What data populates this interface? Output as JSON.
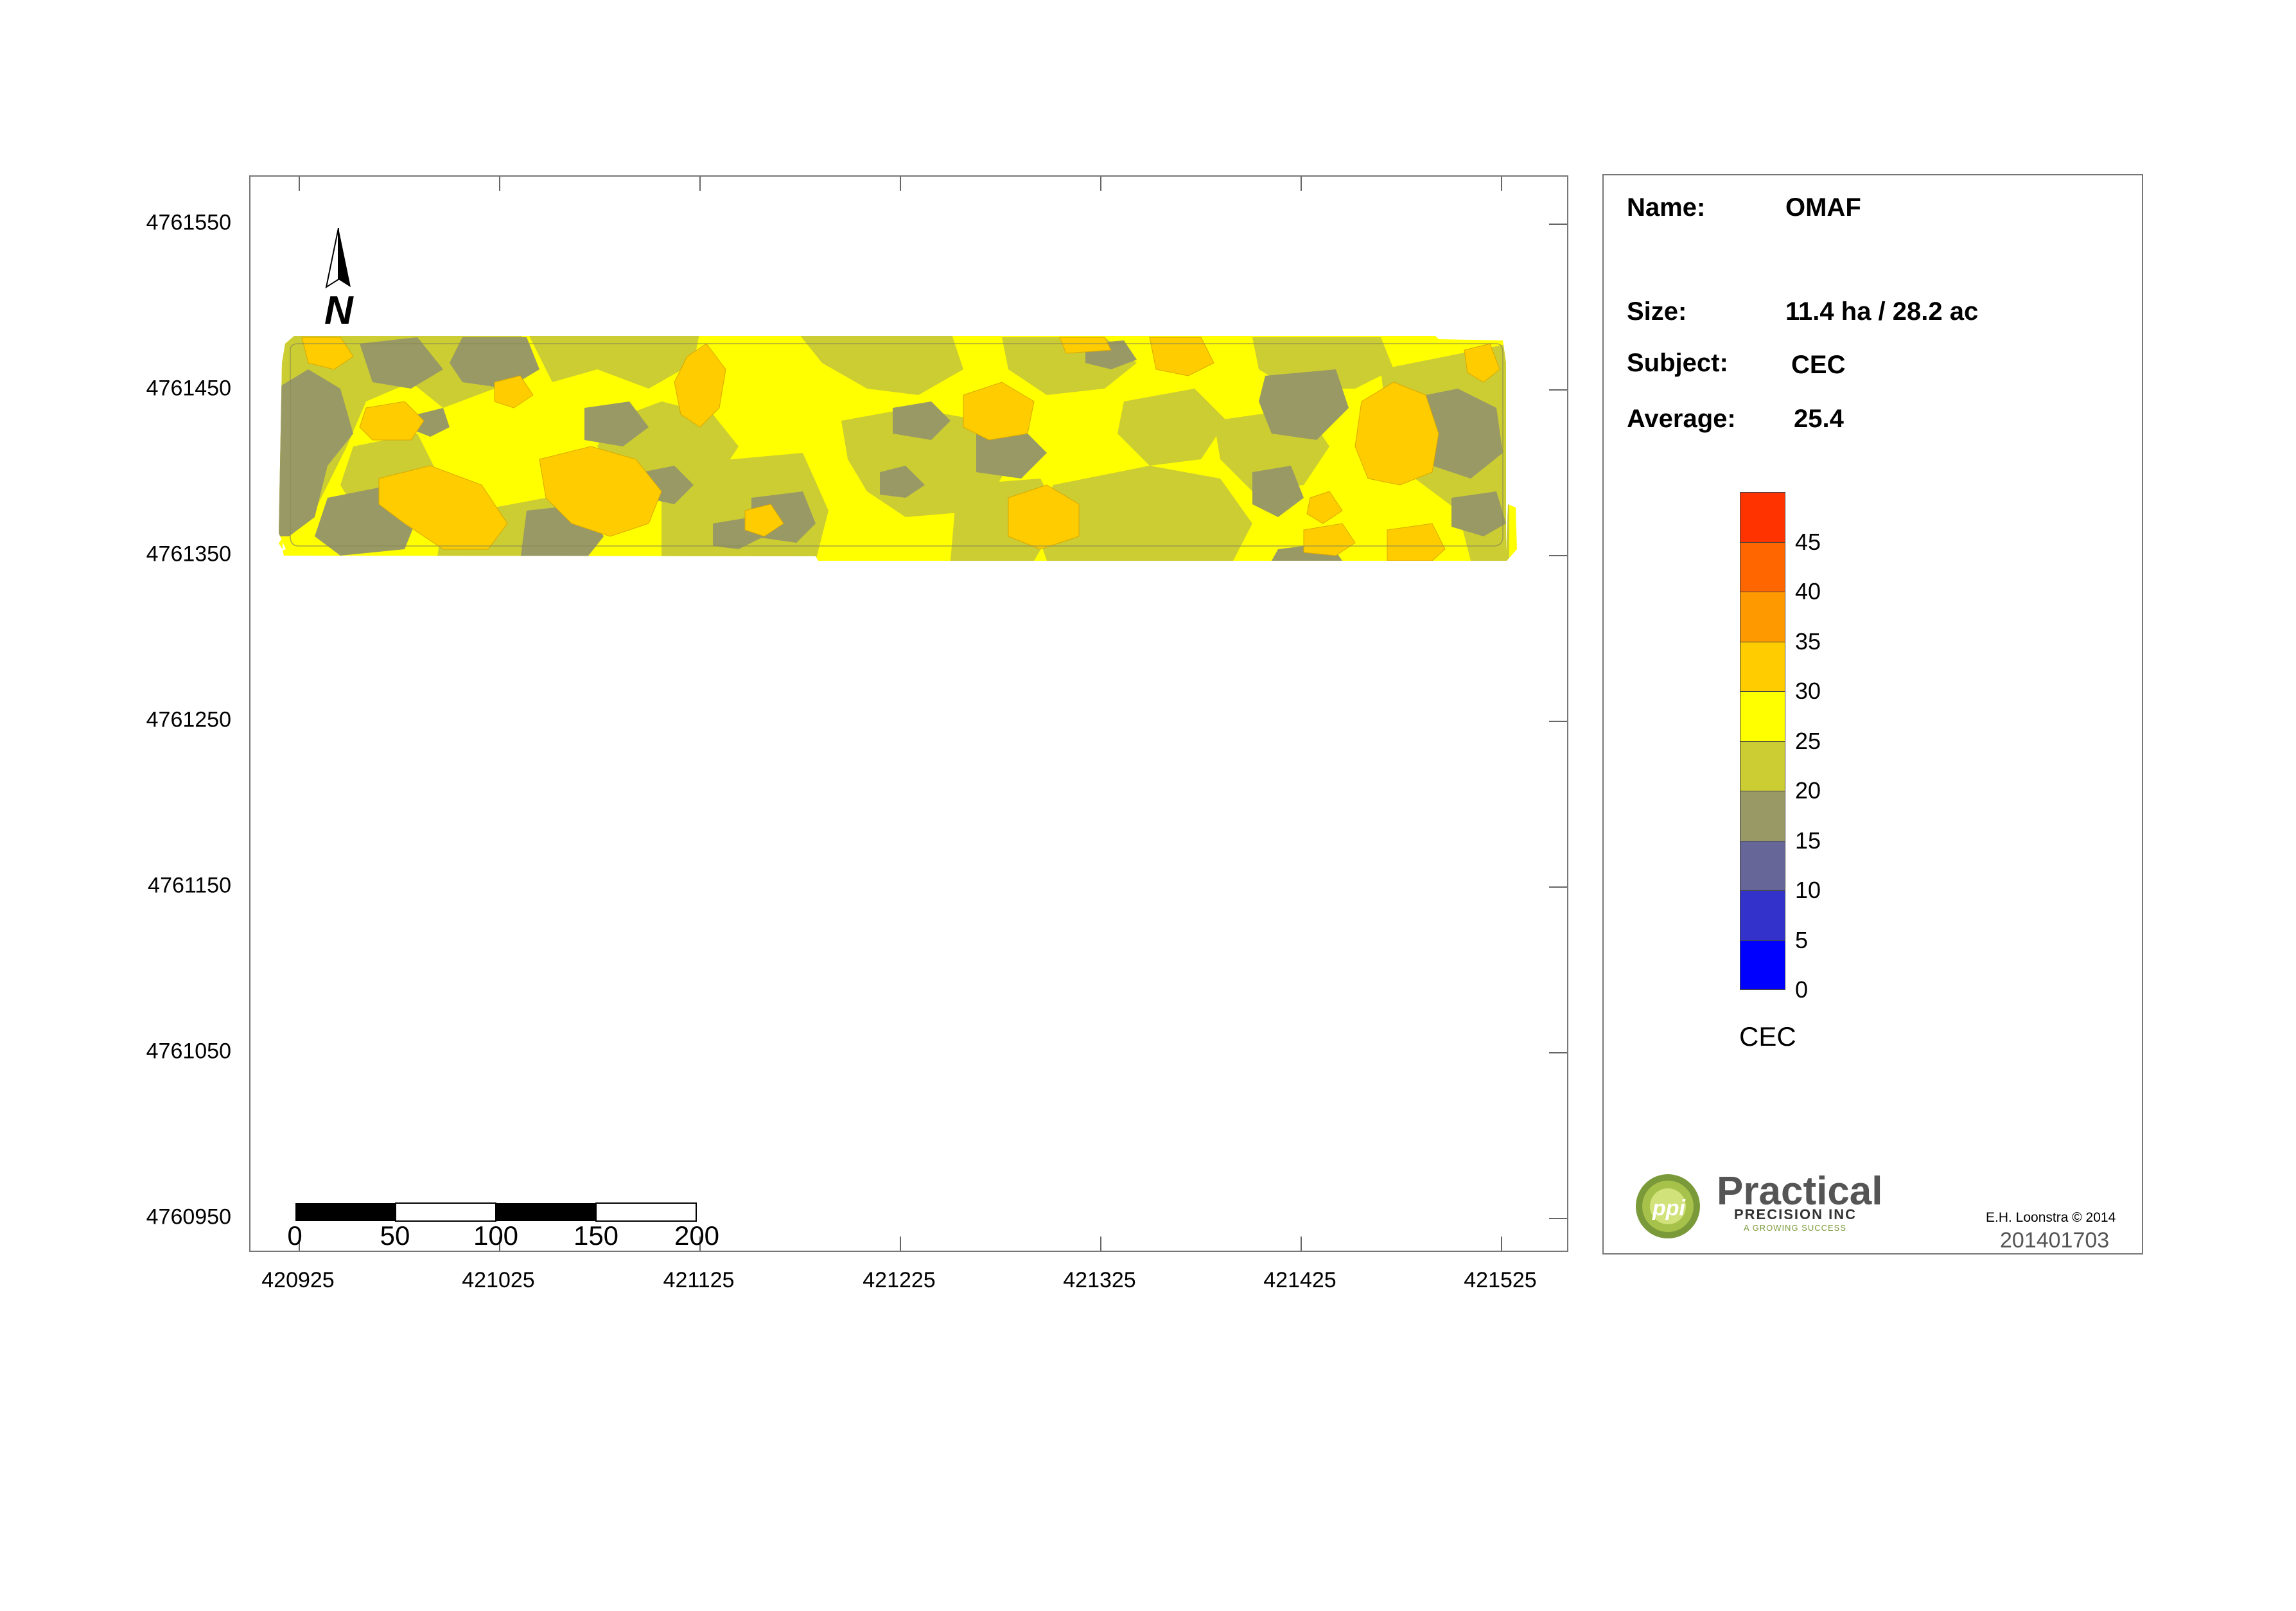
{
  "map": {
    "y_ticks": [
      "4761550",
      "4761450",
      "4761350",
      "4761250",
      "4761150",
      "4761050",
      "4760950"
    ],
    "x_ticks": [
      "420925",
      "421025",
      "421125",
      "421225",
      "421325",
      "421425",
      "421525"
    ],
    "north_label": "N",
    "scale_labels": [
      "0",
      "50",
      "100",
      "150",
      "200"
    ]
  },
  "info": {
    "name_label": "Name:",
    "name_value": "OMAF",
    "size_label": "Size:",
    "size_value": "11.4 ha / 28.2 ac",
    "subject_label": "Subject:",
    "subject_value": "CEC",
    "average_label": "Average:",
    "average_value": "25.4"
  },
  "legend": {
    "title": "CEC",
    "classes": [
      {
        "range": "45-50",
        "color": "#ff3300"
      },
      {
        "range": "40-45",
        "color": "#ff6600"
      },
      {
        "range": "35-40",
        "color": "#ff9900"
      },
      {
        "range": "30-35",
        "color": "#ffcc00"
      },
      {
        "range": "25-30",
        "color": "#ffff00"
      },
      {
        "range": "20-25",
        "color": "#cccc33"
      },
      {
        "range": "15-20",
        "color": "#999966"
      },
      {
        "range": "10-15",
        "color": "#666699"
      },
      {
        "range": "5-10",
        "color": "#3333cc"
      },
      {
        "range": "0-5",
        "color": "#0000ff"
      }
    ],
    "labels": [
      "45",
      "40",
      "35",
      "30",
      "25",
      "20",
      "15",
      "10",
      "5",
      "0"
    ]
  },
  "footer": {
    "logo_main": "Practical",
    "logo_sub": "PRECISION INC",
    "logo_tagline": "A GROWING SUCCESS",
    "logo_badge": "ppi",
    "author": "E.H. Loonstra © 2014",
    "map_id": "201401703"
  }
}
